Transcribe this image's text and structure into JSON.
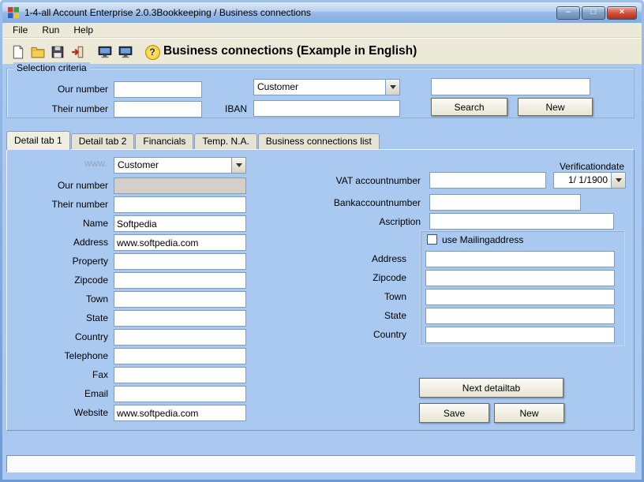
{
  "colors": {
    "client_bg": "#a9c9f0",
    "chrome_bg": "#ece9d8",
    "titlebar_mid": "#97bae6",
    "close_button": "#d4503c",
    "input_border": "#7f9db9",
    "disabled_input_bg": "#d4d0c8"
  },
  "window": {
    "title": "1-4-all Account Enterprise 2.0.3Bookkeeping / Business connections",
    "caption": {
      "minimize": "–",
      "maximize": "□",
      "close": "×"
    }
  },
  "menu": {
    "items": [
      {
        "label": "File"
      },
      {
        "label": "Run"
      },
      {
        "label": "Help"
      }
    ]
  },
  "toolbar": {
    "heading": "Business connections (Example in English)",
    "help_glyph": "?",
    "icons": [
      "new-document",
      "open-folder",
      "save",
      "exit",
      "monitor",
      "monitor",
      "help"
    ]
  },
  "selection": {
    "legend": "Selection criteria",
    "our_number_label": "Our number",
    "our_number_value": "",
    "their_number_label": "Their number",
    "their_number_value": "",
    "type_value": "Customer",
    "iban_label": "IBAN",
    "iban_value": "",
    "free_value": "",
    "search_button": "Search",
    "new_button": "New"
  },
  "tabs": [
    {
      "label": "Detail tab 1",
      "active": true
    },
    {
      "label": "Detail tab 2",
      "active": false
    },
    {
      "label": "Financials",
      "active": false
    },
    {
      "label": "Temp. N.A.",
      "active": false
    },
    {
      "label": "Business connections list",
      "active": false
    }
  ],
  "detail": {
    "watermark": "www.",
    "type_value": "Customer",
    "verificationdate_label": "Verificationdate",
    "left_fields": [
      {
        "label": "Our number",
        "value": ""
      },
      {
        "label": "Their number",
        "value": ""
      },
      {
        "label": "Name",
        "value": "Softpedia"
      },
      {
        "label": "Address",
        "value": "www.softpedia.com"
      },
      {
        "label": "Property",
        "value": ""
      },
      {
        "label": "Zipcode",
        "value": ""
      },
      {
        "label": "Town",
        "value": ""
      },
      {
        "label": "State",
        "value": ""
      },
      {
        "label": "Country",
        "value": ""
      },
      {
        "label": "Telephone",
        "value": ""
      },
      {
        "label": "Fax",
        "value": ""
      },
      {
        "label": "Email",
        "value": ""
      },
      {
        "label": "Website",
        "value": "www.softpedia.com"
      }
    ],
    "vat_label": "VAT accountnumber",
    "vat_value": "",
    "date_value": "1/ 1/1900",
    "bank_label": "Bankaccountnumber",
    "bank_value": "",
    "ascription_label": "Ascription",
    "ascription_value": "",
    "mailing_checkbox_label": "use Mailingaddress",
    "mailing_fields": [
      {
        "label": "Address",
        "value": ""
      },
      {
        "label": "Zipcode",
        "value": ""
      },
      {
        "label": "Town",
        "value": ""
      },
      {
        "label": "State",
        "value": ""
      },
      {
        "label": "Country",
        "value": ""
      }
    ],
    "next_button": "Next detailtab",
    "save_button": "Save",
    "new_button": "New"
  },
  "statusbar": {
    "text": ""
  }
}
